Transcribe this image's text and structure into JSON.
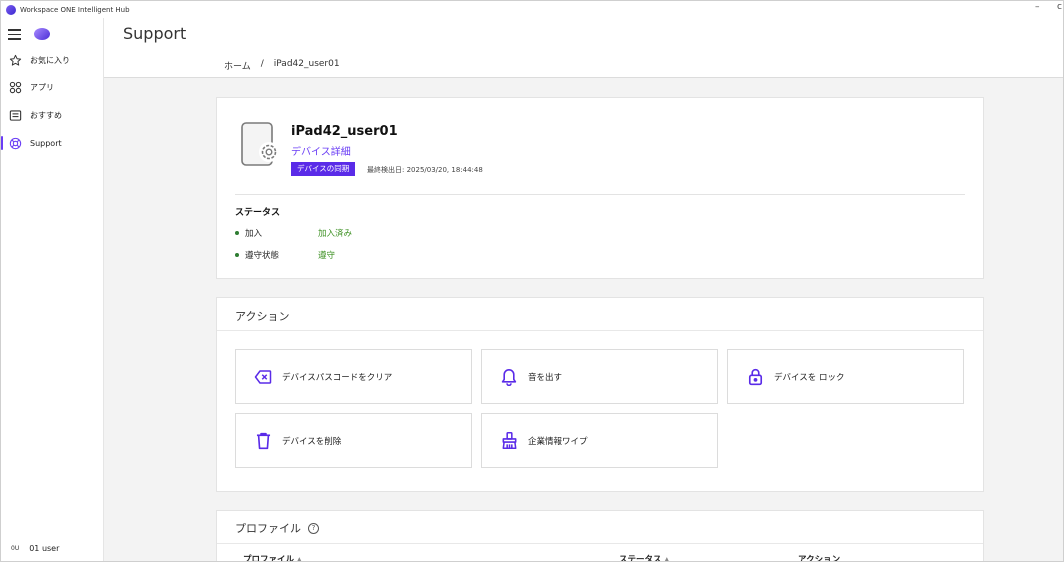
{
  "window": {
    "title": "Workspace ONE Intelligent Hub",
    "minimize": "–",
    "more": "c"
  },
  "sidebar": {
    "items": [
      {
        "label": "お気に入り",
        "icon": "star-icon"
      },
      {
        "label": "アプリ",
        "icon": "apps-icon"
      },
      {
        "label": "おすすめ",
        "icon": "recommend-icon"
      },
      {
        "label": "Support",
        "icon": "support-icon",
        "active": true
      }
    ],
    "user": {
      "initials": "0U",
      "name": "01 user"
    }
  },
  "header": {
    "title": "Support",
    "breadcrumb": {
      "home": "ホーム",
      "separator": "/",
      "current": "iPad42_user01"
    }
  },
  "device": {
    "name": "iPad42_user01",
    "detail_link": "デバイス詳細",
    "sync_button": "デバイスの同期",
    "last_seen": "最終検出日: 2025/03/20, 18:44:48",
    "status_title": "ステータス",
    "status": [
      {
        "label": "加入",
        "value": "加入済み"
      },
      {
        "label": "遵守状態",
        "value": "遵守"
      }
    ]
  },
  "actions": {
    "title": "アクション",
    "buttons": [
      {
        "label": "デバイスパスコードをクリア",
        "icon": "clear-passcode-icon"
      },
      {
        "label": "音を出す",
        "icon": "bell-icon"
      },
      {
        "label": "デバイスを ロック",
        "icon": "lock-icon"
      },
      {
        "label": "デバイスを削除",
        "icon": "trash-icon"
      },
      {
        "label": "企業情報ワイプ",
        "icon": "wipe-icon"
      }
    ]
  },
  "profiles": {
    "title": "プロファイル",
    "help": "?",
    "columns": [
      "プロファイル",
      "ステータス",
      "アクション"
    ]
  },
  "colors": {
    "accent": "#6a3df5",
    "badge": "#5a2be8",
    "status_ok": "#3a8f1f"
  }
}
